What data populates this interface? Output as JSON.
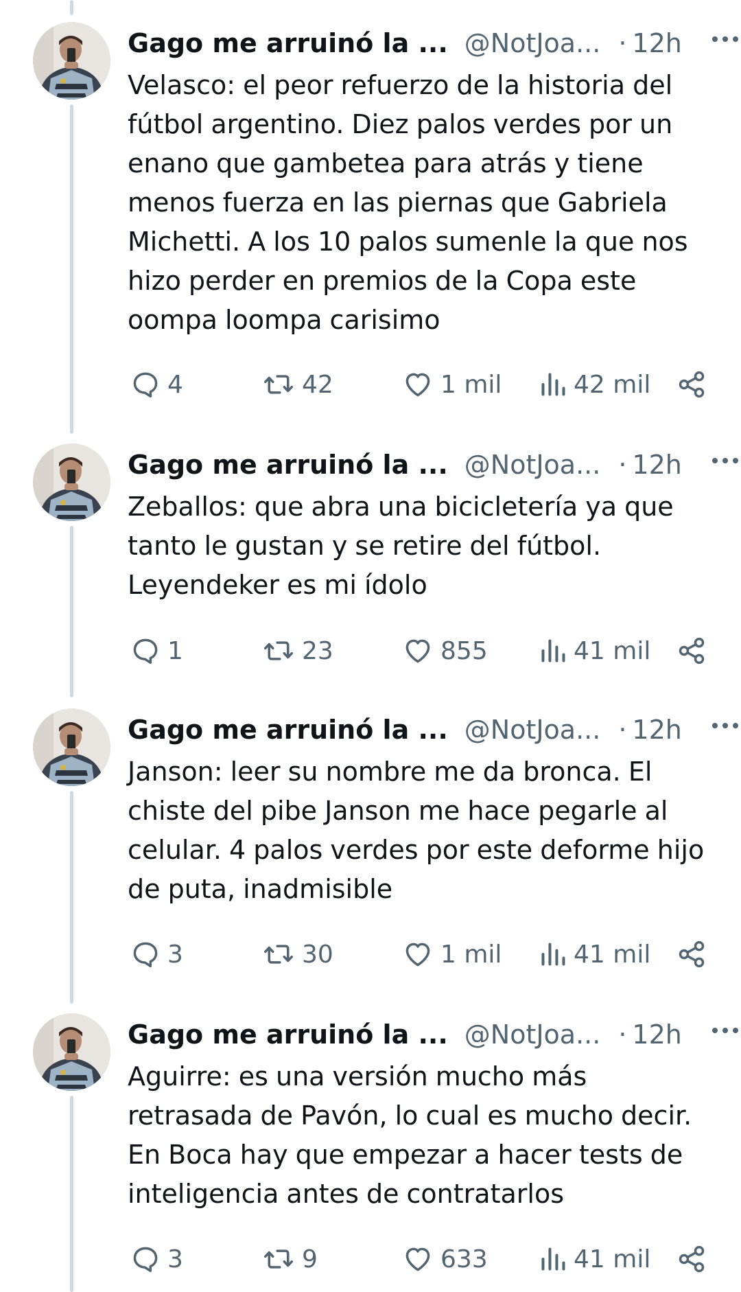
{
  "tweets": [
    {
      "author": {
        "name": "Gago me arruinó la ...",
        "handle": "@NotJoa...",
        "dot": "·",
        "time": "12h"
      },
      "text": "Velasco: el peor refuerzo de la historia del\nfútbol argentino. Diez palos verdes por un\nenano que gambetea para atrás y tiene\nmenos fuerza en las piernas que Gabriela\nMichetti. A los 10 palos sumenle la que nos\nhizo perder en premios de la Copa este\noompa loompa carisimo",
      "stats": {
        "replies": "4",
        "retweets": "42",
        "likes": "1 mil",
        "views": "42 mil"
      }
    },
    {
      "author": {
        "name": "Gago me arruinó la ...",
        "handle": "@NotJoa...",
        "dot": "·",
        "time": "12h"
      },
      "text": "Zeballos: que abra una bicicletería ya que\ntanto le gustan y se retire del fútbol.\nLeyendeker es mi ídolo",
      "stats": {
        "replies": "1",
        "retweets": "23",
        "likes": "855",
        "views": "41 mil"
      }
    },
    {
      "author": {
        "name": "Gago me arruinó la ...",
        "handle": "@NotJoa...",
        "dot": "·",
        "time": "12h"
      },
      "text": "Janson: leer su nombre me da bronca. El\nchiste del pibe Janson me hace pegarle al\ncelular. 4 palos verdes por este deforme hijo\nde puta, inadmisible",
      "stats": {
        "replies": "3",
        "retweets": "30",
        "likes": "1 mil",
        "views": "41 mil"
      }
    },
    {
      "author": {
        "name": "Gago me arruinó la ...",
        "handle": "@NotJoa...",
        "dot": "·",
        "time": "12h"
      },
      "text": "Aguirre: es una versión mucho más\nretrasada de Pavón, lo cual es mucho decir.\nEn Boca hay que empezar a hacer tests de\ninteligencia antes de contratarlos",
      "stats": {
        "replies": "3",
        "retweets": "9",
        "likes": "633",
        "views": "41 mil"
      }
    }
  ],
  "icons": {
    "more": "more-horizontal-icon",
    "reply": "reply-bubble-icon",
    "retweet": "retweet-icon",
    "like": "heart-icon",
    "views": "views-bar-chart-icon",
    "share": "share-icon"
  },
  "colors": {
    "text": "#0f1419",
    "secondary": "#536471",
    "thread_line": "#cfd9de"
  }
}
